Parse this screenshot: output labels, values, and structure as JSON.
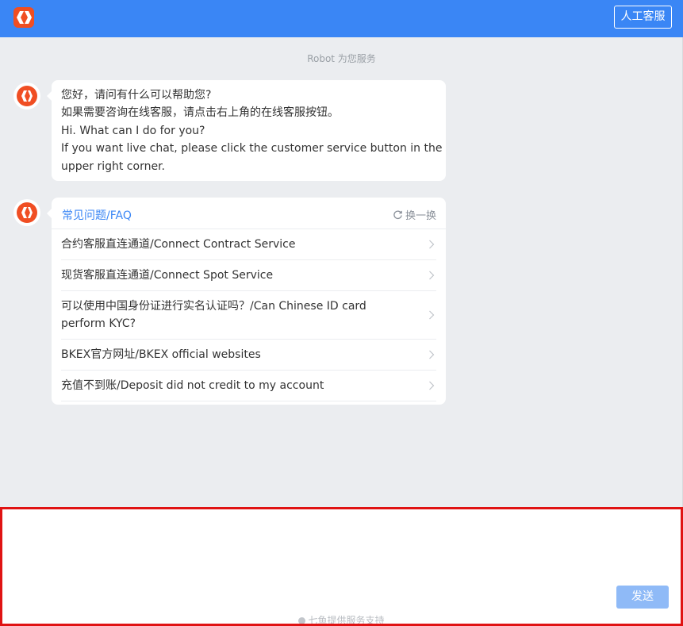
{
  "header": {
    "human_service_label": "人工客服"
  },
  "chat": {
    "service_note": "Robot 为您服务",
    "greeting": {
      "lines": [
        "您好，请问有什么可以帮助您?",
        "如果需要咨询在线客服，请点击右上角的在线客服按钮。",
        "Hi. What can I do for you?",
        "If you want live chat, please click the customer service button in the",
        "upper right corner."
      ]
    },
    "faq": {
      "title": "常见问题/FAQ",
      "refresh_label": "换一换",
      "items": [
        "合约客服直连通道/Connect Contract Service",
        "现货客服直连通道/Connect Spot Service",
        "可以使用中国身份证进行实名认证吗？/Can Chinese ID card perform KYC?",
        "BKEX官方网址/BKEX official websites",
        "充值不到账/Deposit did not credit to my account"
      ]
    }
  },
  "input": {
    "value": "",
    "send_label": "发送",
    "support_text": "七鱼提供服务支持"
  },
  "colors": {
    "brand_blue": "#3a86f5",
    "logo_orange": "#f04e23",
    "send_disabled": "#8fbaf7",
    "highlight_border": "#e01313"
  },
  "icons": {
    "logo": "bkex-logo-icon",
    "refresh": "refresh-icon",
    "chevron": "chevron-right-icon"
  }
}
